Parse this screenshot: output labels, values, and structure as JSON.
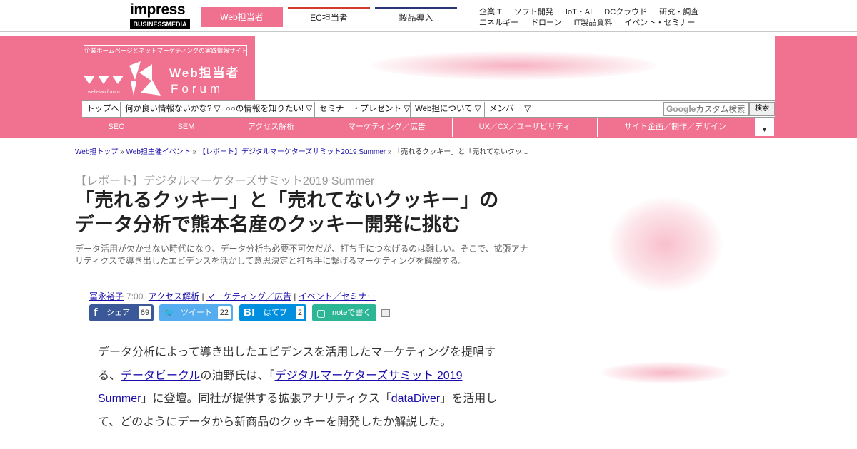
{
  "topbar": {
    "logo_text": "impress",
    "logo_sub": "BUSINESSMEDIA",
    "site_tabs": [
      "Web担当者",
      "EC担当者",
      "製品導入"
    ],
    "links_row1": [
      "企業IT",
      "ソフト開発",
      "IoT・AI",
      "DCクラウド",
      "研究・調査"
    ],
    "links_row2": [
      "エネルギー",
      "ドローン",
      "IT製品資料",
      "イベント・セミナー"
    ]
  },
  "header": {
    "tagline": "企業ホームページとネットマーケティングの実践情報サイト",
    "brand_small": "web-tan forum",
    "brand_title": "Web担当者",
    "brand_sub": "Forum"
  },
  "menu": {
    "items": [
      "トップへ",
      "何か良い情報ないかな? ▽",
      "○○の情報を知りたい! ▽",
      "セミナー・プレゼント ▽",
      "Web担について ▽",
      "メンバー ▽"
    ],
    "search_brand": "Google",
    "search_placeholder": "カスタム検索",
    "search_button": "検索"
  },
  "categories": [
    "SEO",
    "SEM",
    "アクセス解析",
    "マーケティング／広告",
    "UX／CX／ユーザビリティ",
    "サイト企画／制作／デザイン"
  ],
  "category_more": "▼",
  "breadcrumb": {
    "items": [
      "Web担トップ",
      "Web担主催イベント",
      "【レポート】デジタルマーケターズサミット2019 Summer"
    ],
    "current": "「売れるクッキー」と「売れてないクッ...",
    "separator": " » "
  },
  "article": {
    "series": "【レポート】デジタルマーケターズサミット2019 Summer",
    "title_line1": "「売れるクッキー」と「売れてないクッキー」の",
    "title_line2": "データ分析で熊本名産のクッキー開発に挑む",
    "lead": "データ活用が欠かせない時代になり、データ分析も必要不可欠だが、打ち手につなげるのは難しい。そこで、拡張アナリティクスで導き出したエビデンスを活かして意思決定と打ち手に繋げるマーケティングを解説する。",
    "author": "冨永裕子",
    "time": "7:00",
    "tags": [
      "アクセス解析",
      "マーケティング／広告",
      "イベント／セミナー"
    ],
    "share": {
      "facebook": {
        "label": "シェア",
        "count": "69",
        "icon": "f"
      },
      "twitter": {
        "label": "ツイート",
        "count": "22",
        "icon": "🐦"
      },
      "hatena": {
        "label": "はてブ",
        "count": "2",
        "icon": "B!"
      },
      "note": {
        "label": "noteで書く",
        "icon": "▢"
      }
    },
    "body": {
      "t1": "データ分析によって導き出したエビデンスを活用したマーケティングを提唱する、",
      "link1": "データビークル",
      "t2": "の油野氏は、「",
      "link2": "デジタルマーケターズサミット 2019 Summer",
      "t3": "」に登壇。同社が提供する拡張アナリティクス「",
      "link3": "dataDiver",
      "t4": "」を活用して、どのようにデータから新商品のクッキーを開発したか解説した。"
    }
  },
  "colors": {
    "brand_pink": "#f07290",
    "ec_red": "#d33b2a",
    "product_navy": "#2b3679",
    "facebook": "#3b5998",
    "twitter": "#55acee",
    "hatena": "#008fde",
    "note": "#2cb696"
  }
}
